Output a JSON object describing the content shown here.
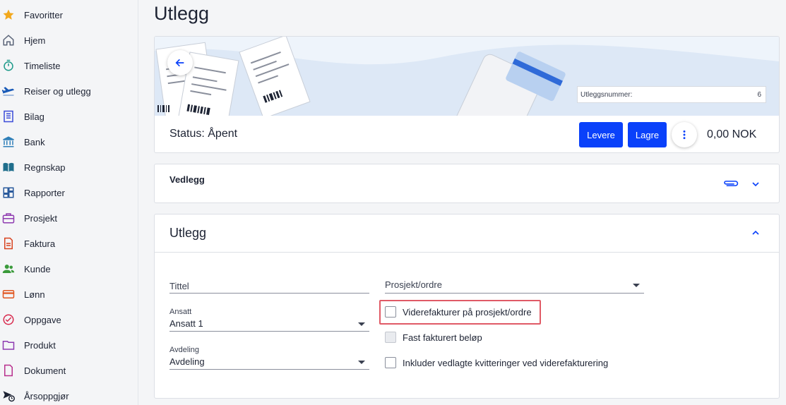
{
  "sidebar": {
    "items": [
      {
        "label": "Favoritter",
        "icon": "star-icon",
        "color": "#f2a81d"
      },
      {
        "label": "Hjem",
        "icon": "home-icon",
        "color": "#5a6478"
      },
      {
        "label": "Timeliste",
        "icon": "stopwatch-icon",
        "color": "#1e9a8a"
      },
      {
        "label": "Reiser og utlegg",
        "icon": "airplane-icon",
        "color": "#1a5bb8"
      },
      {
        "label": "Bilag",
        "icon": "document-lines-icon",
        "color": "#3a4bd8"
      },
      {
        "label": "Bank",
        "icon": "bank-icon",
        "color": "#2e7fb8"
      },
      {
        "label": "Regnskap",
        "icon": "book-icon",
        "color": "#1f6e8c"
      },
      {
        "label": "Rapporter",
        "icon": "dashboard-icon",
        "color": "#2a5a9c"
      },
      {
        "label": "Prosjekt",
        "icon": "briefcase-icon",
        "color": "#8e3ab0"
      },
      {
        "label": "Faktura",
        "icon": "invoice-icon",
        "color": "#d8431f"
      },
      {
        "label": "Kunde",
        "icon": "people-icon",
        "color": "#3a9a3a"
      },
      {
        "label": "Lønn",
        "icon": "card-icon",
        "color": "#e0551f"
      },
      {
        "label": "Oppgave",
        "icon": "check-circle-icon",
        "color": "#d82a4e"
      },
      {
        "label": "Produkt",
        "icon": "folder-icon",
        "color": "#8e3ab0"
      },
      {
        "label": "Dokument",
        "icon": "file-icon",
        "color": "#b8308e"
      },
      {
        "label": "Årsoppgjør",
        "icon": "send-clock-icon",
        "color": "#1d2333"
      }
    ]
  },
  "page": {
    "title": "Utlegg"
  },
  "header_card": {
    "expense_number_label": "Utleggsnummer:",
    "expense_number_value": "6",
    "status": "Status: Åpent",
    "deliver_label": "Levere",
    "save_label": "Lagre",
    "amount": "0,00 NOK"
  },
  "attachments": {
    "title": "Vedlegg"
  },
  "form": {
    "title": "Utlegg",
    "title_field_placeholder": "Tittel",
    "project_placeholder": "Prosjekt/ordre",
    "employee_label": "Ansatt",
    "employee_value": "Ansatt 1",
    "department_label": "Avdeling",
    "department_value": "Avdeling",
    "checkbox_rebill": "Viderefakturer på prosjekt/ordre",
    "checkbox_fixed": "Fast fakturert beløp",
    "checkbox_include": "Inkluder vedlagte kvitteringer ved viderefakturering"
  },
  "colors": {
    "accent": "#0a41fa",
    "highlight": "#e05a66"
  }
}
